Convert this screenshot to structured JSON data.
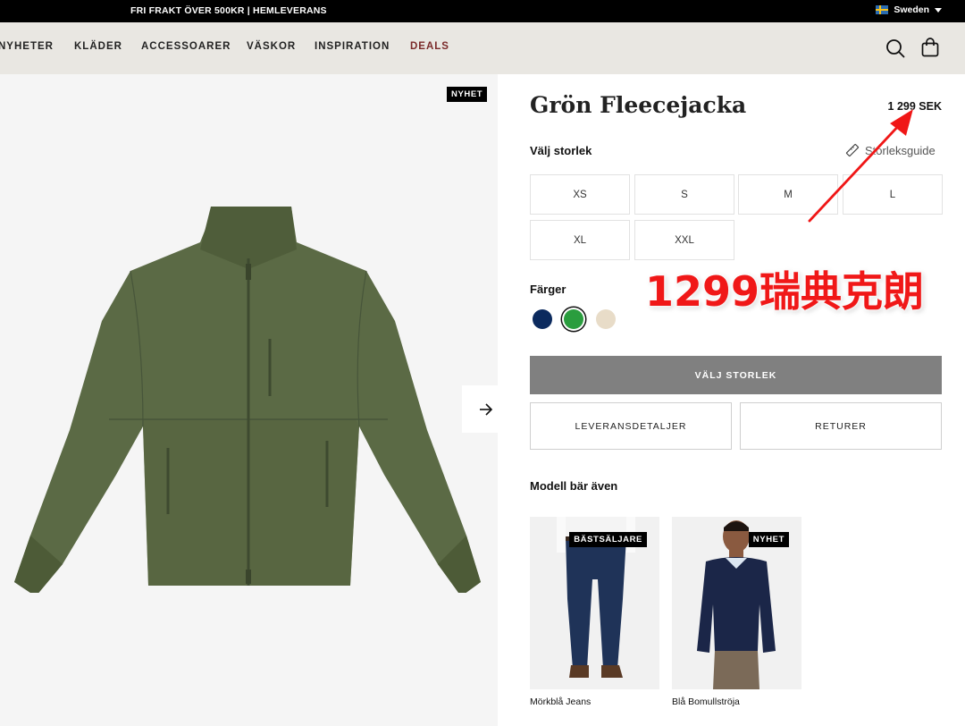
{
  "topbar": {
    "promo": "FRI FRAKT ÖVER 500KR | HEMLEVERANS",
    "region": "Sweden"
  },
  "nav": {
    "items": [
      "NYHETER",
      "KLÄDER",
      "ACCESSOARER",
      "VÄSKOR",
      "INSPIRATION",
      "DEALS"
    ]
  },
  "gallery": {
    "badge": "NYHET"
  },
  "product": {
    "title": "Grön Fleecejacka",
    "price": "1 299 SEK",
    "size_heading": "Välj storlek",
    "size_guide": "Storleksguide",
    "sizes": [
      "XS",
      "S",
      "M",
      "L",
      "XL",
      "XXL"
    ],
    "colors_heading": "Färger",
    "colors": [
      "#0b2a5e",
      "#2a9d3e",
      "#e8dcc8"
    ],
    "selected_color": "#2a9d3e",
    "choose_size_button": "VÄLJ STORLEK",
    "delivery_button": "LEVERANSDETALJER",
    "returns_button": "RETURER"
  },
  "model_wears": {
    "heading": "Modell bär även",
    "items": [
      {
        "name": "Mörkblå Jeans",
        "badge": "BÄSTSÄLJARE"
      },
      {
        "name": "Blå Bomullströja",
        "badge": "NYHET"
      }
    ]
  },
  "annotation": {
    "text": "1299瑞典克朗",
    "color": "#f01818"
  }
}
